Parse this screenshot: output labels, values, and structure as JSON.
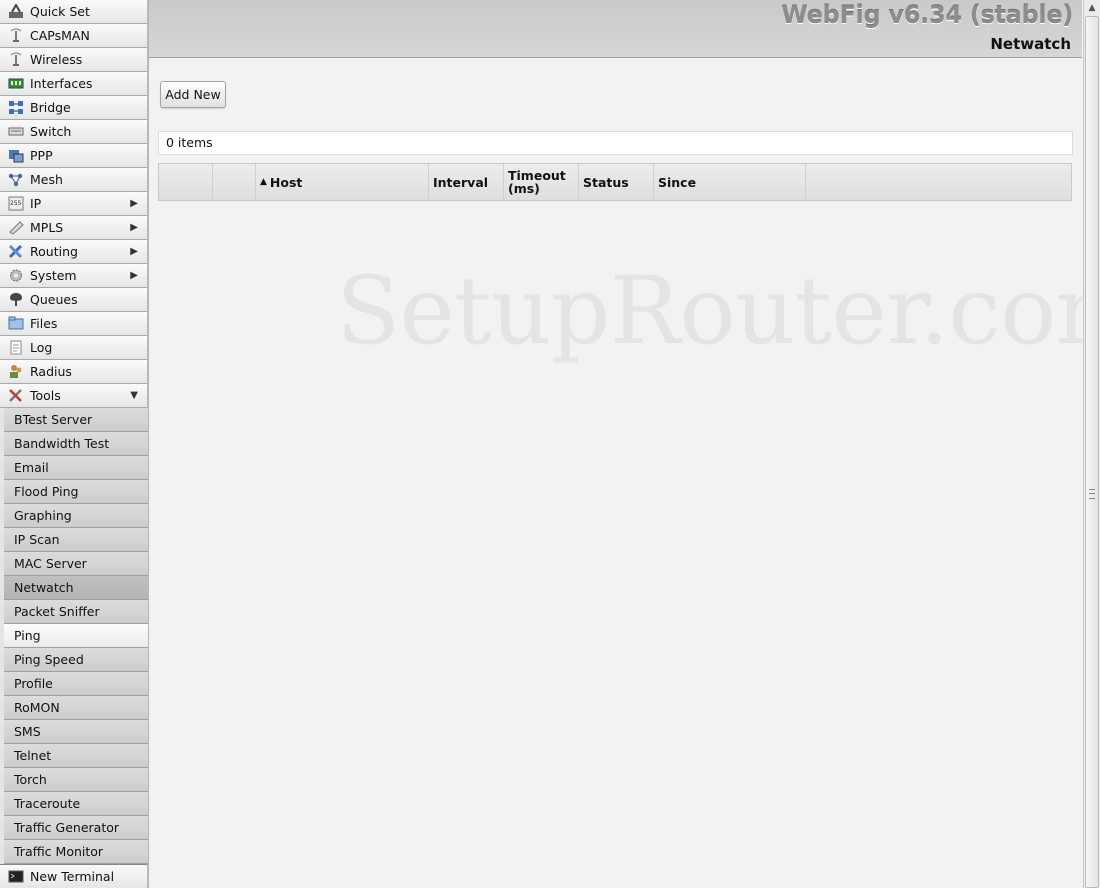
{
  "header": {
    "app_title": "WebFig v6.34 (stable)",
    "page_title": "Netwatch"
  },
  "sidebar": {
    "items": [
      {
        "label": "Quick Set",
        "icon": "quick-set-icon"
      },
      {
        "label": "CAPsMAN",
        "icon": "antenna-icon"
      },
      {
        "label": "Wireless",
        "icon": "antenna-icon"
      },
      {
        "label": "Interfaces",
        "icon": "interfaces-icon"
      },
      {
        "label": "Bridge",
        "icon": "bridge-icon"
      },
      {
        "label": "Switch",
        "icon": "switch-icon"
      },
      {
        "label": "PPP",
        "icon": "ppp-icon"
      },
      {
        "label": "Mesh",
        "icon": "mesh-icon"
      },
      {
        "label": "IP",
        "icon": "ip-icon",
        "arrow": "▶"
      },
      {
        "label": "MPLS",
        "icon": "mpls-icon",
        "arrow": "▶"
      },
      {
        "label": "Routing",
        "icon": "routing-icon",
        "arrow": "▶"
      },
      {
        "label": "System",
        "icon": "gear-icon",
        "arrow": "▶"
      },
      {
        "label": "Queues",
        "icon": "queues-icon"
      },
      {
        "label": "Files",
        "icon": "folder-icon"
      },
      {
        "label": "Log",
        "icon": "log-icon"
      },
      {
        "label": "Radius",
        "icon": "users-icon"
      },
      {
        "label": "Tools",
        "icon": "tools-icon",
        "arrow": "▼"
      }
    ],
    "tools_submenu": [
      "BTest Server",
      "Bandwidth Test",
      "Email",
      "Flood Ping",
      "Graphing",
      "IP Scan",
      "MAC Server",
      "Netwatch",
      "Packet Sniffer",
      "Ping",
      "Ping Speed",
      "Profile",
      "RoMON",
      "SMS",
      "Telnet",
      "Torch",
      "Traceroute",
      "Traffic Generator",
      "Traffic Monitor"
    ],
    "active_submenu": "Netwatch",
    "bottom_item": {
      "label": "New Terminal",
      "icon": "terminal-icon"
    }
  },
  "toolbar": {
    "add_new_label": "Add New"
  },
  "list": {
    "item_count": "0 items",
    "sort_indicator": "▲",
    "columns": [
      "",
      "",
      "Host",
      "Interval",
      "Timeout (ms)",
      "Status",
      "Since",
      ""
    ]
  },
  "watermark": "SetupRouter.com",
  "scrollbar": {
    "up_arrow": "▲"
  }
}
